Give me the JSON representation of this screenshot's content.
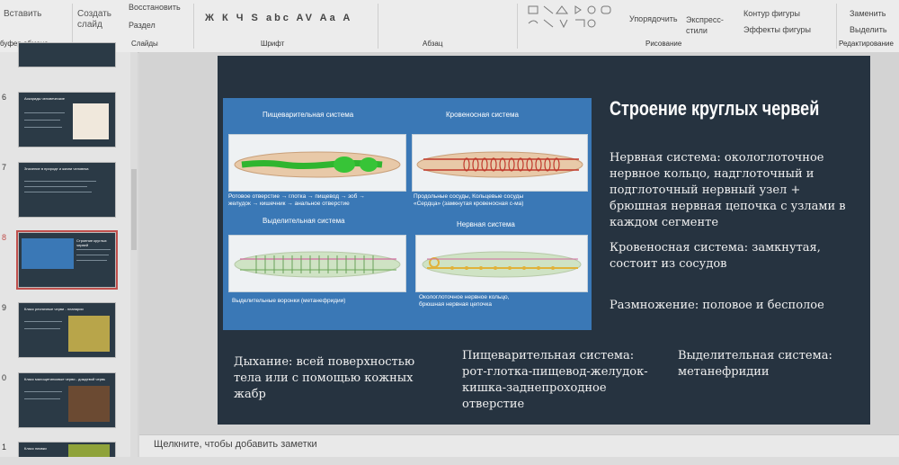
{
  "ribbon": {
    "paste_label": "Вставить",
    "create_slide_label": "Создать\nслайд",
    "restore_label": "Восстановить",
    "section_label": "Раздел",
    "font_buttons": "Ж К Ч S abc AV Aa A",
    "arrange_label": "Упорядочить",
    "express_styles_label": "Экспресс-\nстили",
    "shape_outline_label": "Контур фигуры",
    "shape_effects_label": "Эффекты фигуры",
    "replace_label": "Заменить",
    "select_label": "Выделить",
    "groups": [
      "буфер обмена",
      "Слайды",
      "Шрифт",
      "Абзац",
      "Рисование",
      "Редактирование"
    ]
  },
  "thumbnails": [
    {
      "number": "6",
      "title": "Аскариды человеческие"
    },
    {
      "number": "7",
      "title": "Значение в природе и жизни человека"
    },
    {
      "number": "8",
      "title": "Строение круглых червей"
    },
    {
      "number": "9",
      "title": "Класс ресничные черви - планарии"
    },
    {
      "number": "0",
      "title": "Класс малощетинковые черви - дождевой червь"
    },
    {
      "number": "1",
      "title": "Класс пиявки"
    }
  ],
  "slide": {
    "title": "Строение круглых червей",
    "figure": {
      "digestive_title": "Пищеварительная система",
      "circulatory_title": "Кровеносная система",
      "digestive_caption": "Ротовое отверстие → глотка → пищевод → зоб →\nжелудок → кишечник → анальное отверстие",
      "circulatory_caption": "Продольные сосуды, Кольцевые сосуды\n«Сердца» (замкнутая кровеносная с-ма)",
      "excretory_title": "Выделительная система",
      "nervous_title": "Нервная система",
      "excretory_caption": "Выделительные воронки (метанефридии)",
      "nervous_caption": "Окологлоточное нервное кольцо,\nбрюшная нервная цепочка"
    },
    "nervous_text": "Нервная система: окологлоточное нервное кольцо, надглоточный и подглоточный нервный узел + брюшная нервная цепочка с узлами в каждом сегменте",
    "circulatory_text": "Кровеносная система: замкнутая, состоит из сосудов",
    "reproduction_text": "Размножение: половое и бесполое",
    "breathing_text": "Дыхание: всей поверхностью тела или с помощью кожных жабр",
    "digestive_text": "Пищеварительная система: рот-глотка-пищевод-желудок-кишка-заднепроходное отверстие",
    "excretory_text": "Выделительная система: метанефридии"
  },
  "notes_placeholder": "Щелкните, чтобы добавить заметки",
  "colors": {
    "slide_bg": "#263340",
    "figure_bg": "#3a78b6",
    "accent_selected": "#c0504d"
  }
}
